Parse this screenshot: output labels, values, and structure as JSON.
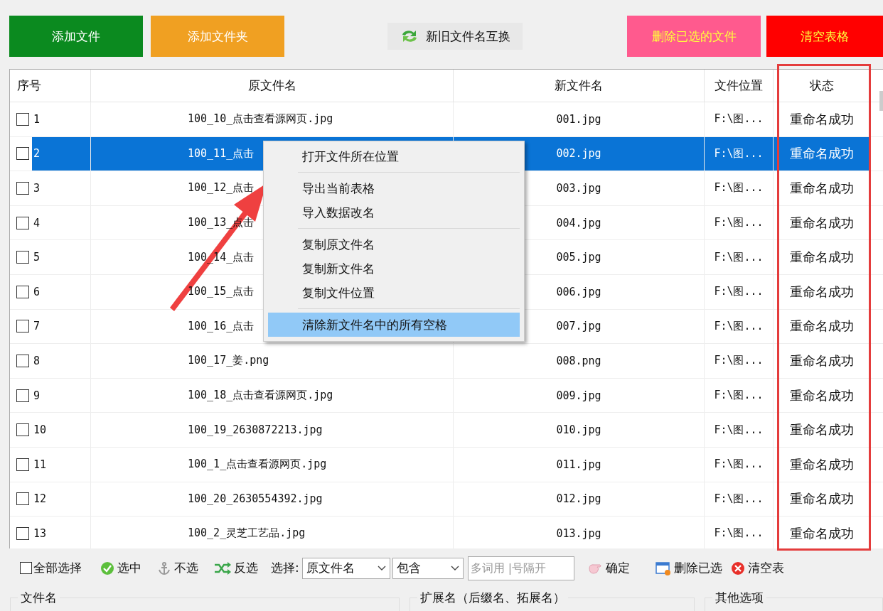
{
  "top_buttons": [
    {
      "label": "添加文件",
      "kind": "add",
      "color": "#0b8a1f"
    },
    {
      "label": "添加文件夹",
      "kind": "add",
      "color": "#f0a022"
    },
    {
      "label": "新旧文件名互换",
      "kind": "swap",
      "color": "#f0f0f0"
    },
    {
      "label": "删除已选的文件",
      "kind": "remove",
      "color": "#ff5a8e"
    },
    {
      "label": "清空表格",
      "kind": "remove",
      "color": "#ff0000"
    }
  ],
  "table": {
    "columns": [
      "序号",
      "原文件名",
      "新文件名",
      "文件位置",
      "状态"
    ],
    "rows": [
      {
        "index": "1",
        "original": "100_10_点击查看源网页.jpg",
        "new": "001.jpg",
        "location": "F:\\图...",
        "status": "重命名成功",
        "checked": false,
        "selected": false
      },
      {
        "index": "2",
        "original": "100_11_点击",
        "new": "002.jpg",
        "location": "F:\\图...",
        "status": "重命名成功",
        "checked": false,
        "selected": true
      },
      {
        "index": "3",
        "original": "100_12_点击",
        "new": "003.jpg",
        "location": "F:\\图...",
        "status": "重命名成功",
        "checked": false,
        "selected": false
      },
      {
        "index": "4",
        "original": "100_13_点击",
        "new": "004.jpg",
        "location": "F:\\图...",
        "status": "重命名成功",
        "checked": false,
        "selected": false
      },
      {
        "index": "5",
        "original": "100_14_点击",
        "new": "005.jpg",
        "location": "F:\\图...",
        "status": "重命名成功",
        "checked": false,
        "selected": false
      },
      {
        "index": "6",
        "original": "100_15_点击",
        "new": "006.jpg",
        "location": "F:\\图...",
        "status": "重命名成功",
        "checked": false,
        "selected": false
      },
      {
        "index": "7",
        "original": "100_16_点击",
        "new": "007.jpg",
        "location": "F:\\图...",
        "status": "重命名成功",
        "checked": false,
        "selected": false
      },
      {
        "index": "8",
        "original": "100_17_姜.png",
        "new": "008.png",
        "location": "F:\\图...",
        "status": "重命名成功",
        "checked": false,
        "selected": false
      },
      {
        "index": "9",
        "original": "100_18_点击查看源网页.jpg",
        "new": "009.jpg",
        "location": "F:\\图...",
        "status": "重命名成功",
        "checked": false,
        "selected": false
      },
      {
        "index": "10",
        "original": "100_19_2630872213.jpg",
        "new": "010.jpg",
        "location": "F:\\图...",
        "status": "重命名成功",
        "checked": false,
        "selected": false
      },
      {
        "index": "11",
        "original": "100_1_点击查看源网页.jpg",
        "new": "011.jpg",
        "location": "F:\\图...",
        "status": "重命名成功",
        "checked": false,
        "selected": false
      },
      {
        "index": "12",
        "original": "100_20_2630554392.jpg",
        "new": "012.jpg",
        "location": "F:\\图...",
        "status": "重命名成功",
        "checked": false,
        "selected": false
      },
      {
        "index": "13",
        "original": "100_2_灵芝工艺品.jpg",
        "new": "013.jpg",
        "location": "F:\\图...",
        "status": "重命名成功",
        "checked": false,
        "selected": false
      }
    ]
  },
  "context_menu": {
    "groups": [
      [
        {
          "label": "打开文件所在位置",
          "selected": false
        }
      ],
      [
        {
          "label": "导出当前表格",
          "selected": false
        },
        {
          "label": "导入数据改名",
          "selected": false
        }
      ],
      [
        {
          "label": "复制原文件名",
          "selected": false
        },
        {
          "label": "复制新文件名",
          "selected": false
        },
        {
          "label": "复制文件位置",
          "selected": false
        }
      ],
      [
        {
          "label": "清除新文件名中的所有空格",
          "selected": true
        }
      ]
    ]
  },
  "toolbar": {
    "select_all": {
      "label": "全部选择",
      "checked": false
    },
    "actions": [
      {
        "label": "选中",
        "kind": "check"
      },
      {
        "label": "不选",
        "kind": "anchor"
      },
      {
        "label": "反选",
        "kind": "shuffle"
      }
    ],
    "filter_label": "选择:",
    "field_dropdown": "原文件名",
    "match_dropdown": "包含",
    "keyword": {
      "placeholder": "多词用 |号隔开"
    },
    "confirm": "确定",
    "delete_selected": "删除已选",
    "clear": "清空表"
  },
  "groups": [
    "文件名",
    "扩展名（后缀名、拓展名）",
    "其他选项"
  ]
}
